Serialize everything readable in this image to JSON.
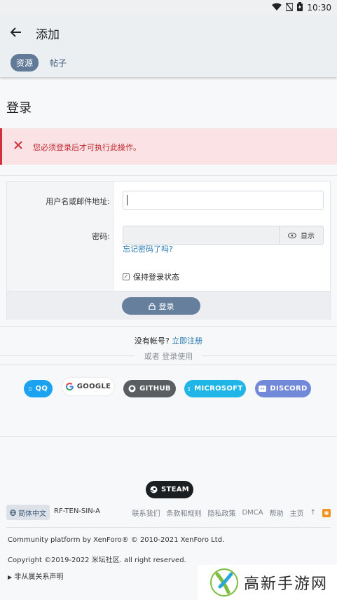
{
  "status_bar": {
    "time": "10:30"
  },
  "app_bar": {
    "title": "添加",
    "tabs": [
      {
        "label": "资源",
        "active": true
      },
      {
        "label": "帖子",
        "active": false
      }
    ]
  },
  "page": {
    "title": "登录"
  },
  "error": {
    "message": "您必须登录后才可执行此操作。"
  },
  "form": {
    "username_label": "用户名或邮件地址:",
    "username_value": "",
    "password_label": "密码:",
    "password_value": "",
    "show_label": "显示",
    "forgot_link": "忘记密码了吗?",
    "remember_label": "保持登录状态",
    "remember_checked": true,
    "login_button": "登录"
  },
  "register": {
    "prompt": "没有帐号?",
    "link": "立即注册",
    "or_with": "或者 登录使用"
  },
  "social": [
    {
      "label": "QQ",
      "color": "#1ba2f0"
    },
    {
      "label": "GOOGLE",
      "color": "#ffffff"
    },
    {
      "label": "GITHUB",
      "color": "#5b5e61"
    },
    {
      "label": "MICROSOFT",
      "color": "#1fb5e7"
    },
    {
      "label": "DISCORD",
      "color": "#7289da"
    },
    {
      "label": "STEAM",
      "color": "#1c1f22"
    }
  ],
  "footer": {
    "language": "简体中文",
    "style": "RF-TEN-SIN-A",
    "links": [
      "联系我们",
      "条款和规则",
      "隐私政策",
      "DMCA",
      "帮助",
      "主页"
    ],
    "platform_line": "Community platform by XenForo® © 2010-2021 XenForo Ltd.",
    "copyright_line": "Copyright ©2019-2022 米坛社区. all right reserved.",
    "disclaimer": "非从属关系声明"
  },
  "watermark": {
    "text": "高新手游网"
  }
}
